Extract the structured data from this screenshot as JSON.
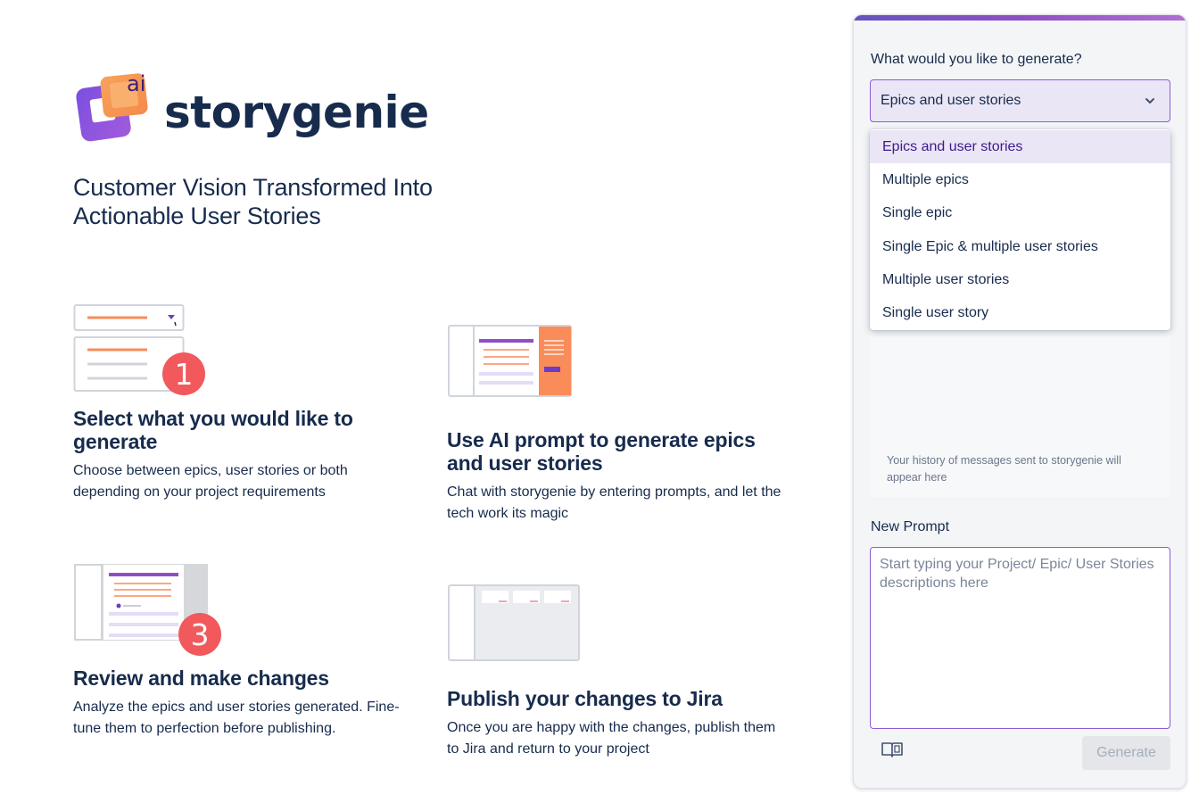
{
  "brand": {
    "logo_text": "ai",
    "name": "storygenie"
  },
  "tagline": "Customer Vision Transformed Into Actionable User Stories",
  "steps": [
    {
      "badge": "1",
      "title": "Select what you would like to generate",
      "desc": "Choose between epics, user stories or both depending on your project requirements"
    },
    {
      "title": "Use AI prompt to generate epics and user stories",
      "desc": "Chat with storygenie by entering prompts, and let the tech work its magic"
    },
    {
      "badge": "3",
      "title": "Review and make changes",
      "desc": "Analyze the epics and user stories generated. Fine-tune them to perfection before publishing."
    },
    {
      "title": "Publish your changes to Jira",
      "desc": "Once you are happy with the changes, publish them to Jira and return to your project"
    }
  ],
  "panel": {
    "question": "What would you like to generate?",
    "selected": "Epics and user stories",
    "options": [
      "Epics and user stories",
      "Multiple epics",
      "Single epic",
      "Single Epic & multiple user stories",
      "Multiple user stories",
      "Single user story"
    ],
    "history_placeholder": "Your history of messages sent to storygenie will appear here",
    "new_prompt_label": "New Prompt",
    "prompt_placeholder": "Start typing your Project/ Epic/ User Stories descriptions here",
    "generate_label": "Generate"
  },
  "colors": {
    "accent": "#8e5bd4",
    "selected_bg": "#eae6f6",
    "badge": "#f1595c",
    "orange": "#fa8c5a",
    "heading": "#172b4d"
  }
}
